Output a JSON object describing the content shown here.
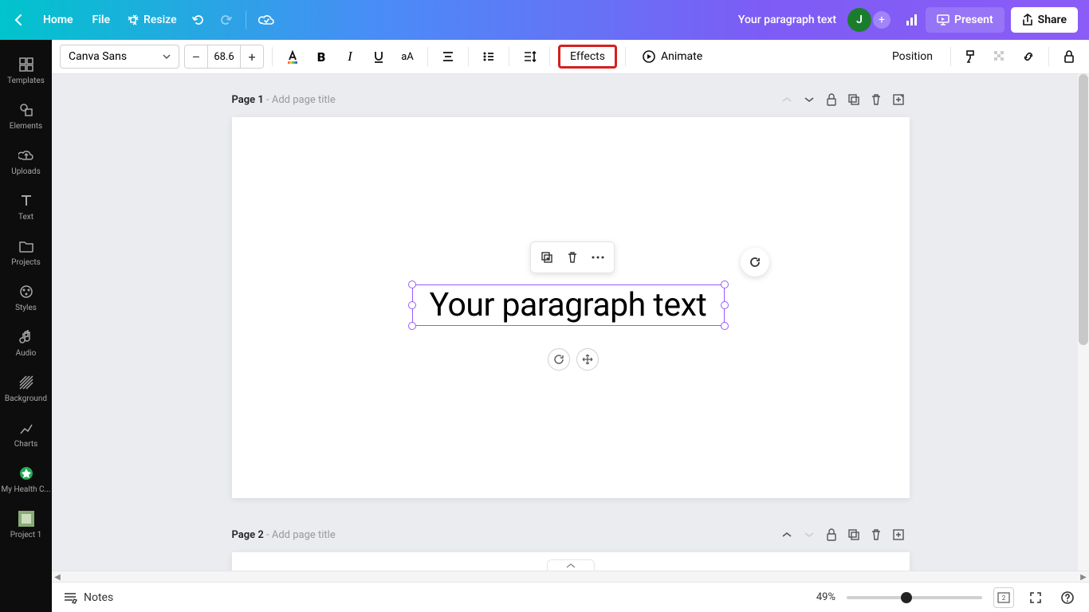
{
  "topbar": {
    "home": "Home",
    "file": "File",
    "resize": "Resize",
    "docname": "Your paragraph text",
    "avatar_initial": "J",
    "present": "Present",
    "share": "Share"
  },
  "sidebar": {
    "items": [
      {
        "label": "Templates"
      },
      {
        "label": "Elements"
      },
      {
        "label": "Uploads"
      },
      {
        "label": "Text"
      },
      {
        "label": "Projects"
      },
      {
        "label": "Styles"
      },
      {
        "label": "Audio"
      },
      {
        "label": "Background"
      },
      {
        "label": "Charts"
      },
      {
        "label": "My Health C..."
      },
      {
        "label": "Project 1"
      }
    ]
  },
  "toolbar": {
    "font": "Canva Sans",
    "size": "68.6",
    "effects": "Effects",
    "animate": "Animate",
    "position": "Position"
  },
  "pages": [
    {
      "num": "Page 1",
      "dash": " - ",
      "placeholder": "Add page title"
    },
    {
      "num": "Page 2",
      "dash": " - ",
      "placeholder": "Add page title"
    }
  ],
  "canvas": {
    "text": "Your paragraph text"
  },
  "bottom": {
    "notes": "Notes",
    "zoom": "49%",
    "page_count": "2"
  }
}
